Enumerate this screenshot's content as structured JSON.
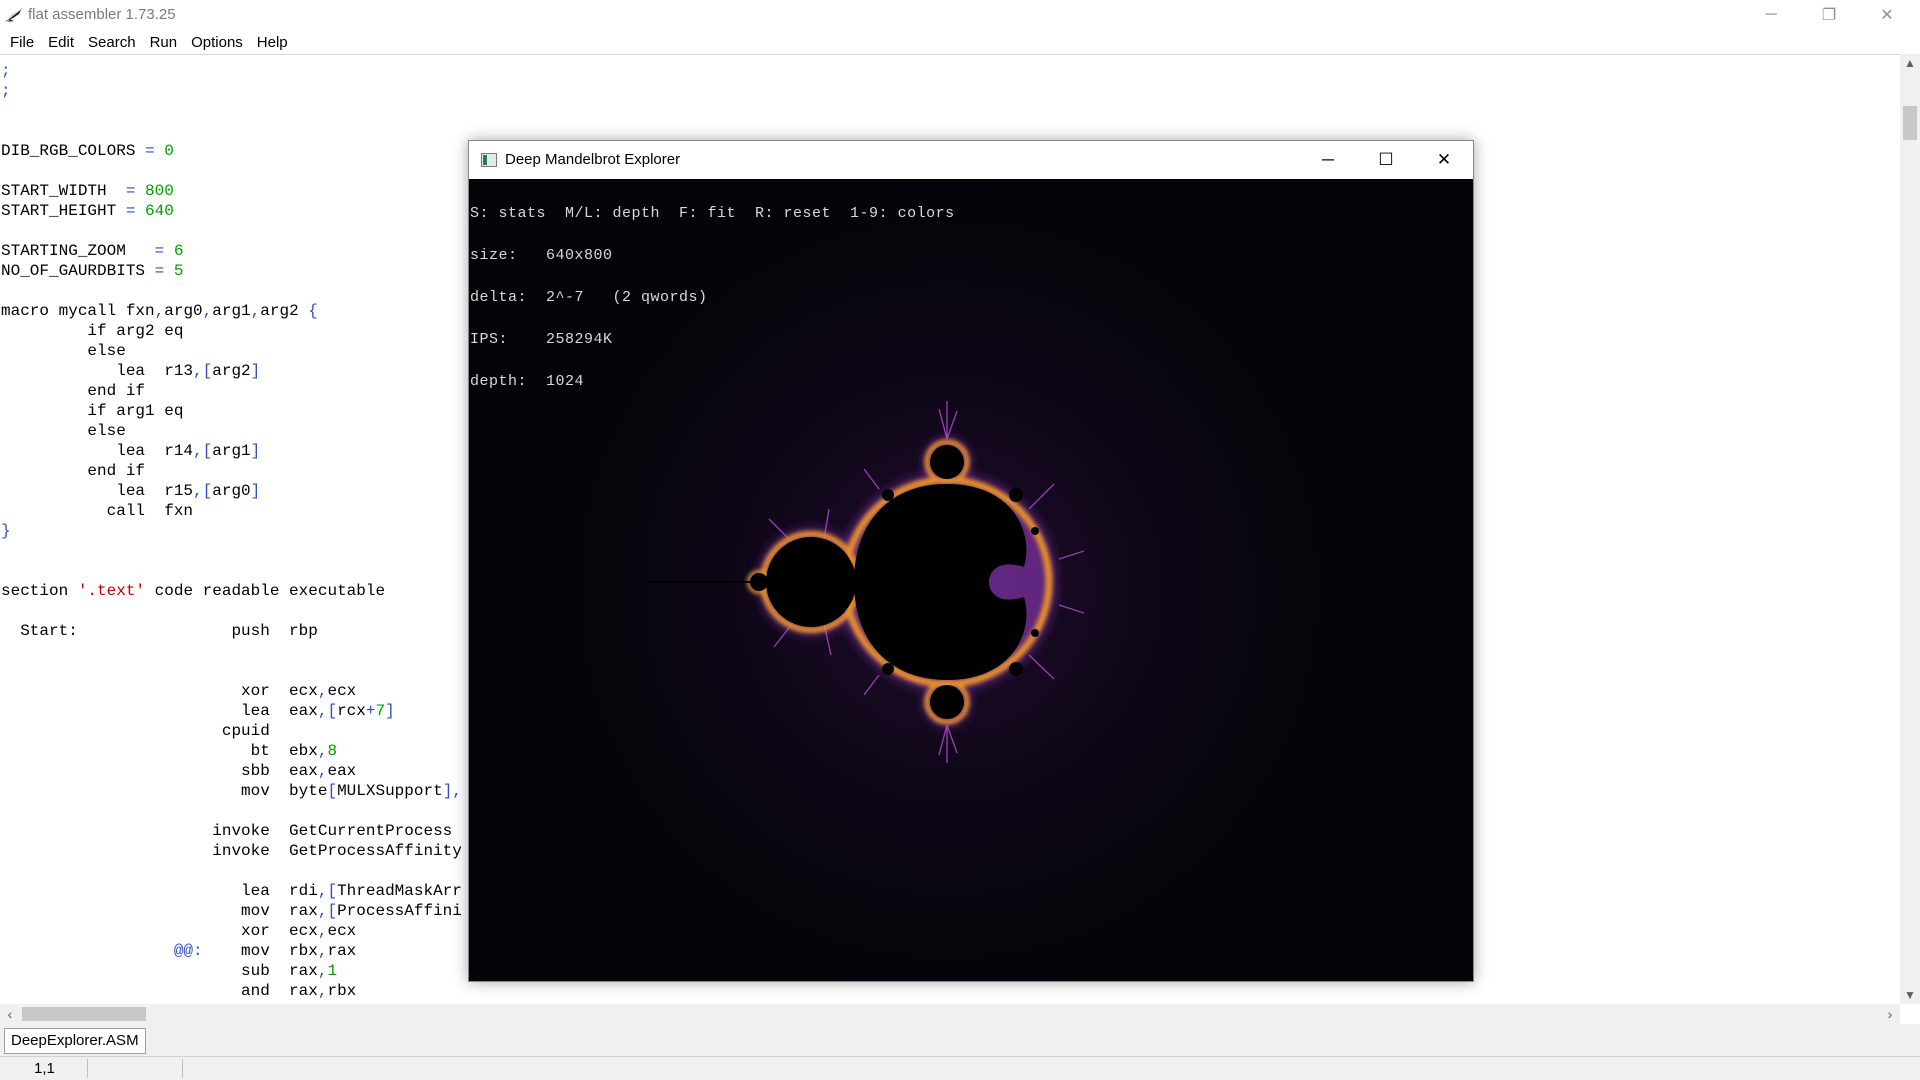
{
  "app": {
    "title": "flat assembler 1.73.25",
    "icon": "fasm-feather-icon"
  },
  "window_controls": {
    "minimize": "─",
    "restore": "❐",
    "close": "✕"
  },
  "menu": [
    "File",
    "Edit",
    "Search",
    "Run",
    "Options",
    "Help"
  ],
  "editor": {
    "lines": [
      {
        "y": 0,
        "parts": [
          {
            "t": ";",
            "c": "sym"
          }
        ]
      },
      {
        "y": 1,
        "parts": [
          {
            "t": ";",
            "c": "sym"
          }
        ]
      },
      {
        "y": 4,
        "parts": [
          {
            "t": "DIB_RGB_COLORS "
          },
          {
            "t": "=",
            "c": "sym"
          },
          {
            "t": " "
          },
          {
            "t": "0",
            "c": "num"
          }
        ]
      },
      {
        "y": 6,
        "parts": [
          {
            "t": "START_WIDTH  "
          },
          {
            "t": "=",
            "c": "sym"
          },
          {
            "t": " "
          },
          {
            "t": "800",
            "c": "num"
          }
        ]
      },
      {
        "y": 7,
        "parts": [
          {
            "t": "START_HEIGHT "
          },
          {
            "t": "=",
            "c": "sym"
          },
          {
            "t": " "
          },
          {
            "t": "640",
            "c": "num"
          }
        ]
      },
      {
        "y": 9,
        "parts": [
          {
            "t": "STARTING_ZOOM   "
          },
          {
            "t": "=",
            "c": "sym"
          },
          {
            "t": " "
          },
          {
            "t": "6",
            "c": "num"
          }
        ]
      },
      {
        "y": 10,
        "parts": [
          {
            "t": "NO_OF_GAURDBITS "
          },
          {
            "t": "=",
            "c": "sym"
          },
          {
            "t": " "
          },
          {
            "t": "5",
            "c": "num"
          }
        ]
      },
      {
        "y": 12,
        "parts": [
          {
            "t": "macro mycall fxn"
          },
          {
            "t": ",",
            "c": "sym"
          },
          {
            "t": "arg0"
          },
          {
            "t": ",",
            "c": "sym"
          },
          {
            "t": "arg1"
          },
          {
            "t": ",",
            "c": "sym"
          },
          {
            "t": "arg2 "
          },
          {
            "t": "{",
            "c": "sym"
          }
        ]
      },
      {
        "y": 13,
        "parts": [
          {
            "t": "         if arg2 eq"
          }
        ]
      },
      {
        "y": 14,
        "parts": [
          {
            "t": "         else"
          }
        ]
      },
      {
        "y": 15,
        "parts": [
          {
            "t": "            lea  r13"
          },
          {
            "t": ",[",
            "c": "sym"
          },
          {
            "t": "arg2"
          },
          {
            "t": "]",
            "c": "sym"
          }
        ]
      },
      {
        "y": 16,
        "parts": [
          {
            "t": "         end if"
          }
        ]
      },
      {
        "y": 17,
        "parts": [
          {
            "t": "         if arg1 eq"
          }
        ]
      },
      {
        "y": 18,
        "parts": [
          {
            "t": "         else"
          }
        ]
      },
      {
        "y": 19,
        "parts": [
          {
            "t": "            lea  r14"
          },
          {
            "t": ",[",
            "c": "sym"
          },
          {
            "t": "arg1"
          },
          {
            "t": "]",
            "c": "sym"
          }
        ]
      },
      {
        "y": 20,
        "parts": [
          {
            "t": "         end if"
          }
        ]
      },
      {
        "y": 21,
        "parts": [
          {
            "t": "            lea  r15"
          },
          {
            "t": ",[",
            "c": "sym"
          },
          {
            "t": "arg0"
          },
          {
            "t": "]",
            "c": "sym"
          }
        ]
      },
      {
        "y": 22,
        "parts": [
          {
            "t": "           call  fxn"
          }
        ]
      },
      {
        "y": 23,
        "parts": [
          {
            "t": "}",
            "c": "sym"
          }
        ]
      },
      {
        "y": 26,
        "parts": [
          {
            "t": "section "
          },
          {
            "t": "'.text'",
            "c": "str"
          },
          {
            "t": " code readable executable"
          }
        ]
      },
      {
        "y": 28,
        "parts": [
          {
            "t": "  Start:                push  rbp"
          }
        ]
      },
      {
        "y": 31,
        "parts": [
          {
            "t": "                         xor  ecx"
          },
          {
            "t": ",",
            "c": "sym"
          },
          {
            "t": "ecx"
          }
        ]
      },
      {
        "y": 32,
        "parts": [
          {
            "t": "                         lea  eax"
          },
          {
            "t": ",[",
            "c": "sym"
          },
          {
            "t": "rcx"
          },
          {
            "t": "+",
            "c": "sym"
          },
          {
            "t": "7",
            "c": "num"
          },
          {
            "t": "]",
            "c": "sym"
          }
        ]
      },
      {
        "y": 33,
        "parts": [
          {
            "t": "                       cpuid"
          }
        ]
      },
      {
        "y": 34,
        "parts": [
          {
            "t": "                          bt  ebx"
          },
          {
            "t": ",",
            "c": "sym"
          },
          {
            "t": "8",
            "c": "num"
          }
        ]
      },
      {
        "y": 35,
        "parts": [
          {
            "t": "                         sbb  eax"
          },
          {
            "t": ",",
            "c": "sym"
          },
          {
            "t": "eax"
          }
        ]
      },
      {
        "y": 36,
        "parts": [
          {
            "t": "                         mov  byte"
          },
          {
            "t": "[",
            "c": "sym"
          },
          {
            "t": "MULXSupport"
          },
          {
            "t": "],",
            "c": "sym"
          }
        ]
      },
      {
        "y": 38,
        "parts": [
          {
            "t": "                      invoke  GetCurrentProcess"
          }
        ]
      },
      {
        "y": 39,
        "parts": [
          {
            "t": "                      invoke  GetProcessAffinity"
          }
        ]
      },
      {
        "y": 41,
        "parts": [
          {
            "t": "                         lea  rdi"
          },
          {
            "t": ",[",
            "c": "sym"
          },
          {
            "t": "ThreadMaskArr"
          }
        ]
      },
      {
        "y": 42,
        "parts": [
          {
            "t": "                         mov  rax"
          },
          {
            "t": ",[",
            "c": "sym"
          },
          {
            "t": "ProcessAffini"
          }
        ]
      },
      {
        "y": 43,
        "parts": [
          {
            "t": "                         xor  ecx"
          },
          {
            "t": ",",
            "c": "sym"
          },
          {
            "t": "ecx"
          }
        ]
      },
      {
        "y": 44,
        "parts": [
          {
            "t": "                  "
          },
          {
            "t": "@@:",
            "c": "sym"
          },
          {
            "t": "    mov  rbx"
          },
          {
            "t": ",",
            "c": "sym"
          },
          {
            "t": "rax"
          }
        ]
      },
      {
        "y": 45,
        "parts": [
          {
            "t": "                         sub  rax"
          },
          {
            "t": ",",
            "c": "sym"
          },
          {
            "t": "1",
            "c": "num"
          }
        ]
      },
      {
        "y": 46,
        "parts": [
          {
            "t": "                         and  rax"
          },
          {
            "t": ",",
            "c": "sym"
          },
          {
            "t": "rbx"
          }
        ]
      }
    ]
  },
  "tab": {
    "label": "DeepExplorer.ASM"
  },
  "status": {
    "position": "1,1"
  },
  "child_window": {
    "title": "Deep Mandelbrot Explorer",
    "controls": {
      "minimize": "─",
      "maximize": "☐",
      "close": "✕"
    },
    "overlay": [
      "S: stats  M/L: depth  F: fit  R: reset  1-9: colors",
      "size:   640x800",
      "delta:  2^-7   (2 qwords)",
      "IPS:    258294K",
      "depth:  1024"
    ]
  },
  "colors": {
    "number": "#00a000",
    "string": "#c00000",
    "symbol": "#3050c0",
    "fractal_edge": "#f0a030",
    "fractal_glow": "#b040c0"
  }
}
